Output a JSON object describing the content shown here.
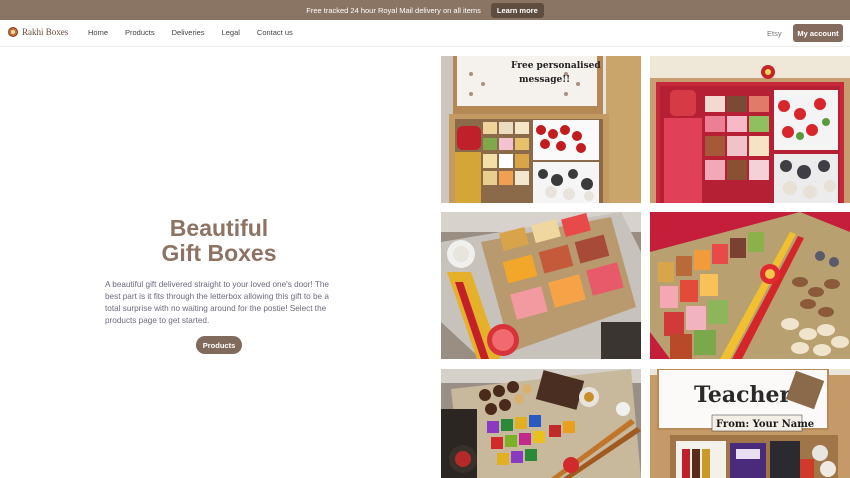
{
  "banner": {
    "message": "Free tracked 24 hour Royal Mail delivery on all items",
    "cta": "Learn more"
  },
  "nav": {
    "logo_text": "Rakhi Boxes",
    "items": [
      {
        "label": "Home"
      },
      {
        "label": "Products"
      },
      {
        "label": "Deliveries"
      },
      {
        "label": "Legal"
      },
      {
        "label": "Contact us"
      }
    ],
    "etsy": "Etsy",
    "account": "My account"
  },
  "hero": {
    "title_line1": "Beautiful",
    "title_line2": "Gift Boxes",
    "description": "A beautiful gift delivered straight to your loved one's door! The best part is it fits through the letterbox allowing this gift to be a total surprise with no waiting around for the postie! Select the products page to get started.",
    "button": "Products"
  },
  "gallery": {
    "photo1_card_text": "Free personalised message!!",
    "photo6_card_title": "Teacher",
    "photo6_card_from": "From: Your Name"
  },
  "colors": {
    "banner_bg": "#8a7565",
    "accent": "#836c5d",
    "title": "#8c7363"
  }
}
